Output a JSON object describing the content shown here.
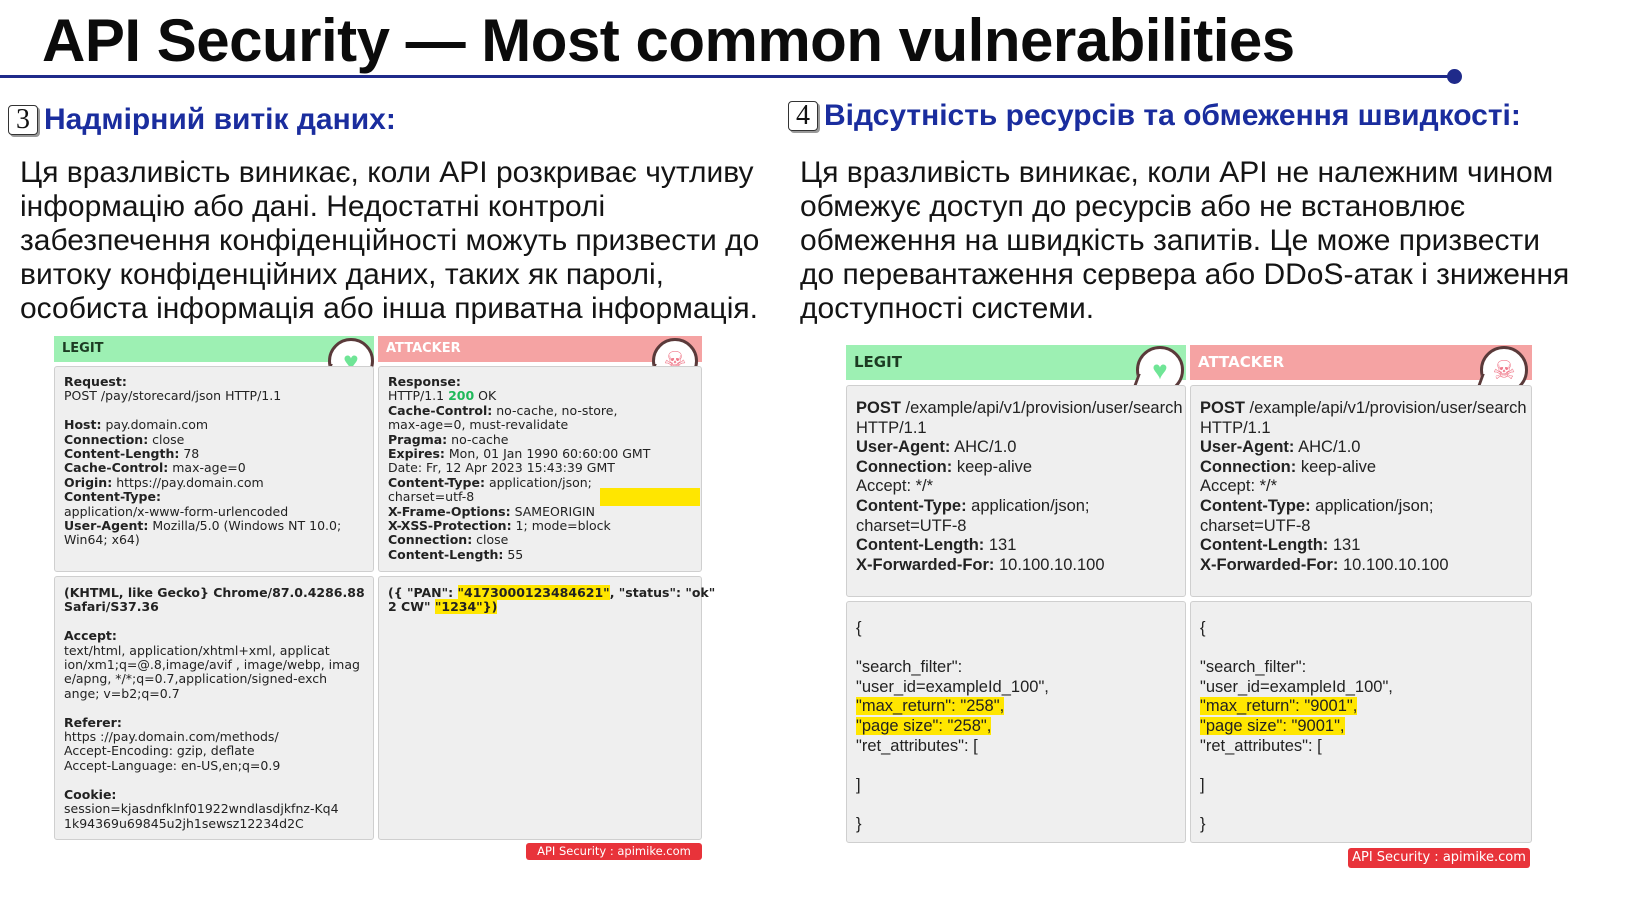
{
  "title": "API Security — Most common vulnerabilities",
  "left": {
    "num": "3",
    "heading": "Надмірний витік даних:",
    "paragraph": "Ця вразливість виникає, коли API розкриває чутливу\nінформацію або дані. Недостатні контролі\nзабезпечення конфіденційності можуть призвести до\nвитоку конфіденційних даних, таких як паролі,\nособиста інформація або інша приватна інформація.",
    "legit_label": "LEGIT",
    "attacker_label": "ATTACKER",
    "legit_top": [
      {
        "b": "Request:"
      },
      {
        "t": "POST /pay/storecard/json HTTP/1.1"
      },
      {
        "t": " "
      },
      {
        "b": "Host:",
        "t": " pay.domain.com"
      },
      {
        "b": "Connection:",
        "t": " close"
      },
      {
        "b": "Content-Length:",
        "t": " 78"
      },
      {
        "b": "Cache-Control:",
        "t": " max-age=0"
      },
      {
        "b": "Origin:",
        "t": " https://pay.domain.com"
      },
      {
        "b": "Content-Type:"
      },
      {
        "t": "application/x-www-form-urlencoded"
      },
      {
        "b": "User-Agent:",
        "t": " Mozilla/5.0 (Windows NT 10.0;"
      },
      {
        "t": "Win64; x64)"
      }
    ],
    "legit_bottom": [
      {
        "b": "(KHTML, like Gecko} Chrome/87.0.4286.88"
      },
      {
        "b": "Safari/S37.36"
      },
      {
        "t": " "
      },
      {
        "b": "Accept:"
      },
      {
        "t": "text/html, application/xhtml+xml, applicat"
      },
      {
        "t": "ion/xm1;q=@.8,image/avif , image/webp, imag"
      },
      {
        "t": "e/apng, */*;q=0.7,application/signed-exch"
      },
      {
        "t": "ange; v=b2;q=0.7"
      },
      {
        "t": " "
      },
      {
        "b": "Referer:"
      },
      {
        "t": "https ://pay.domain.com/methods/"
      },
      {
        "t": "Accept-Encoding: gzip, deflate"
      },
      {
        "t": "Accept-Language: en-US,en;q=0.9"
      },
      {
        "t": " "
      },
      {
        "b": "Cookie:"
      },
      {
        "t": "session=kjasdnfklnf01922wndlasdjkfnz-Kq4"
      },
      {
        "t": "1k94369u69845u2jh1sewsz12234d2C"
      }
    ],
    "attacker_top": [
      {
        "b": "Response:"
      },
      {
        "t": "HTTP/1.1 ",
        "ok": "200",
        "t2": " OK"
      },
      {
        "b": "Cache-Control:",
        "t": " no-cache, no-store,"
      },
      {
        "t": "max-age=0, must-revalidate"
      },
      {
        "b": "Pragma:",
        "t": " no-cache"
      },
      {
        "b": "Expires:",
        "t": " Mon, 01 Jan 1990 60:60:00 GMT"
      },
      {
        "t": "Date: Fr, 12 Apr 2023 15:43:39 GMT"
      },
      {
        "b": "Content-Type:",
        "t": " application/json;"
      },
      {
        "t": "charset=utf-8"
      },
      {
        "b": "X-Frame-Options:",
        "t": " SAMEORIGIN"
      },
      {
        "b": "X-XSS-Protection:",
        "t": " 1; mode=block"
      },
      {
        "b": "Connection:",
        "t": " close"
      },
      {
        "b": "Content-Length:",
        "t": " 55"
      }
    ],
    "attacker_bottom": [
      {
        "b": "({ \"PAN\": ",
        "hb": "\"4173000123484621\"",
        "b2": ", \"status\": \"ok\""
      },
      {
        "b": "2 CW\" ",
        "hb": "\"1234\"})"
      }
    ],
    "badge": "API Security : apimike.com"
  },
  "right": {
    "num": "4",
    "heading": "Відсутність ресурсів та обмеження швидкості:",
    "paragraph": "Ця вразливість виникає, коли API не належним чином\nобмежує доступ до ресурсів або не встановлює\nобмеження на швидкість запитів. Це може призвести\nдо перевантаження сервера або DDoS-атак і зниження\nдоступності системи.",
    "legit_label": "LEGIT",
    "attacker_label": "ATTACKER",
    "legit_top": [
      {
        "b": "POST",
        "t": " /example/api/v1/provision/user/search"
      },
      {
        "t": "HTTP/1.1"
      },
      {
        "b": "User-Agent:",
        "t": " AHC/1.0"
      },
      {
        "b": "Connection:",
        "t": " keep-alive"
      },
      {
        "t": "Accept: */*"
      },
      {
        "b": "Content-Type:",
        "t": " application/json;"
      },
      {
        "t": "charset=UTF-8"
      },
      {
        "b": "Content-Length:",
        "t": " 131"
      },
      {
        "b": "X-Forwarded-For:",
        "t": " 10.100.10.100"
      }
    ],
    "legit_bottom": [
      {
        "t": "{"
      },
      {
        "t": " "
      },
      {
        "t": "\"search_filter\":"
      },
      {
        "t": "\"user_id=exampleId_100\","
      },
      {
        "h": "\"max_return\": \"258\","
      },
      {
        "h": "\"page size\": \"258\","
      },
      {
        "t": "\"ret_attributes\": ["
      },
      {
        "t": " "
      },
      {
        "t": "]"
      },
      {
        "t": " "
      },
      {
        "t": "}"
      }
    ],
    "attacker_top": [
      {
        "b": "POST",
        "t": " /example/api/v1/provision/user/search"
      },
      {
        "t": "HTTP/1.1"
      },
      {
        "b": "User-Agent:",
        "t": " AHC/1.0"
      },
      {
        "b": "Connection:",
        "t": " keep-alive"
      },
      {
        "t": "Accept: */*"
      },
      {
        "b": "Content-Type:",
        "t": " application/json;"
      },
      {
        "t": "charset=UTF-8"
      },
      {
        "b": "Content-Length:",
        "t": " 131"
      },
      {
        "b": "X-Forwarded-For:",
        "t": " 10.100.10.100"
      }
    ],
    "attacker_bottom": [
      {
        "t": "{"
      },
      {
        "t": " "
      },
      {
        "t": "\"search_filter\":"
      },
      {
        "t": "\"user_id=exampleId_100\","
      },
      {
        "h": "\"max_return\": \"9001\","
      },
      {
        "h": "\"page size\": \"9001\","
      },
      {
        "t": "\"ret_attributes\": ["
      },
      {
        "t": " "
      },
      {
        "t": "]"
      },
      {
        "t": " "
      },
      {
        "t": "}"
      }
    ],
    "badge": "API Security : apimike.com"
  },
  "icons": {
    "legit": "heart-icon",
    "attacker": "skull-icon"
  },
  "colors": {
    "heading": "#1a2d9e",
    "legit": "#9df0b3",
    "attacker": "#f5a3a3",
    "highlight": "#ffe600",
    "badge": "#e8333a"
  }
}
